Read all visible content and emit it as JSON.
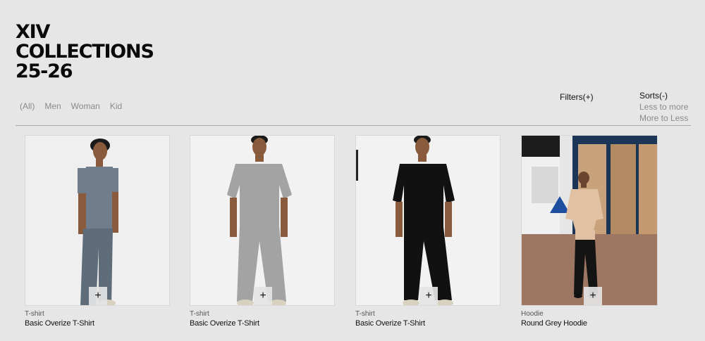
{
  "header": {
    "title_lines": [
      "XIV",
      "COLLECTIONS",
      "25-26"
    ]
  },
  "categories": [
    "(All)",
    "Men",
    "Woman",
    "Kid"
  ],
  "filters": {
    "label": "Filters(+)"
  },
  "sorts": {
    "label": "Sorts(-)",
    "options": [
      "Less to more",
      "More to Less"
    ]
  },
  "products": [
    {
      "category": "T-shirt",
      "name": "Basic Overize T-Shirt",
      "add_label": "+",
      "color": "#6f7d8c"
    },
    {
      "category": "T-shirt",
      "name": "Basic Overize T-Shirt",
      "add_label": "+",
      "color": "#a3a3a3"
    },
    {
      "category": "T-shirt",
      "name": "Basic Overize T-Shirt",
      "add_label": "+",
      "color": "#111111"
    },
    {
      "category": "Hoodie",
      "name": "Round Grey Hoodie",
      "add_label": "+",
      "color": "#e2c0a4"
    }
  ]
}
